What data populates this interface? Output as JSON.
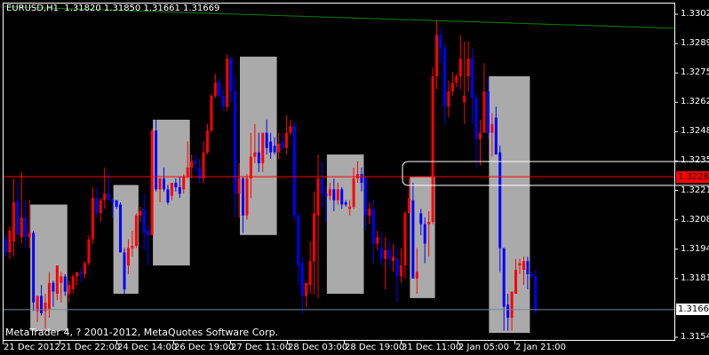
{
  "header": {
    "symbol": "EURUSD,H1",
    "open": "1.31820",
    "high": "1.31850",
    "low": "1.31661",
    "close": "1.31669"
  },
  "footer": {
    "copyright": "MetaTrader 4, ? 2001-2012, MetaQuotes Software Corp."
  },
  "colors": {
    "background": "#000000",
    "bull": "#ff0000",
    "bear": "#0000ff",
    "frame": "#ffffff",
    "box": "#aaaaaa",
    "trendline": "#008000",
    "hline": "#ff0000",
    "bid_line": "#778899"
  },
  "price_axis": {
    "labels": [
      "1.33025",
      "1.32890",
      "1.32755",
      "1.32620",
      "1.32485",
      "1.32350",
      "1.32215",
      "1.32080",
      "1.31945",
      "1.31810",
      "1.31540"
    ]
  },
  "time_axis": {
    "labels": [
      "21 Dec 2012",
      "21 Dec 22:00",
      "24 Dec 14:00",
      "26 Dec 19:00",
      "27 Dec 11:00",
      "28 Dec 03:00",
      "28 Dec 19:00",
      "31 Dec 11:00",
      "2 Jan 05:00",
      "2 Jan 21:00"
    ]
  },
  "markers": {
    "hline_price": "1.32280",
    "bid_price": "1.31669"
  },
  "chart_data": {
    "type": "candlestick",
    "ylim": [
      1.3151,
      1.3311
    ],
    "ohlc_order": "open,high,low,close",
    "candles": [
      [
        1.3199,
        1.3201,
        1.3191,
        1.3193
      ],
      [
        1.3193,
        1.3205,
        1.319,
        1.3203
      ],
      [
        1.3198,
        1.3227,
        1.3191,
        1.3216
      ],
      [
        1.3217,
        1.3225,
        1.3201,
        1.3201
      ],
      [
        1.32,
        1.323,
        1.3197,
        1.3209
      ],
      [
        1.3209,
        1.3217,
        1.3195,
        1.32
      ],
      [
        1.32,
        1.3217,
        1.3195,
        1.3202
      ],
      [
        1.3202,
        1.3203,
        1.3166,
        1.317
      ],
      [
        1.3166,
        1.3173,
        1.3161,
        1.3173
      ],
      [
        1.3173,
        1.3178,
        1.3164,
        1.3165
      ],
      [
        1.3166,
        1.3174,
        1.3158,
        1.317
      ],
      [
        1.3167,
        1.3184,
        1.3163,
        1.3179
      ],
      [
        1.3179,
        1.318,
        1.3168,
        1.3175
      ],
      [
        1.3174,
        1.3187,
        1.3171,
        1.3187
      ],
      [
        1.3179,
        1.3184,
        1.317,
        1.3182
      ],
      [
        1.3182,
        1.3183,
        1.3173,
        1.3175
      ],
      [
        1.3174,
        1.318,
        1.317,
        1.3178
      ],
      [
        1.3176,
        1.3183,
        1.3174,
        1.3182
      ],
      [
        1.3182,
        1.3184,
        1.3178,
        1.3184
      ],
      [
        1.3184,
        1.3186,
        1.3179,
        1.3183
      ],
      [
        1.3183,
        1.3189,
        1.3181,
        1.3188
      ],
      [
        1.3188,
        1.3201,
        1.3187,
        1.3199
      ],
      [
        1.3199,
        1.3223,
        1.3197,
        1.3218
      ],
      [
        1.3218,
        1.3223,
        1.3209,
        1.3211
      ],
      [
        1.3211,
        1.3218,
        1.3207,
        1.3217
      ],
      [
        1.3217,
        1.3232,
        1.3213,
        1.322
      ],
      [
        1.322,
        1.3229,
        1.3217,
        1.3217
      ],
      [
        1.3217,
        1.3218,
        1.3209,
        1.3216
      ],
      [
        1.3217,
        1.3217,
        1.3213,
        1.3214
      ],
      [
        1.3215,
        1.3216,
        1.3193,
        1.3193
      ],
      [
        1.3193,
        1.3195,
        1.3174,
        1.3176
      ],
      [
        1.3187,
        1.3199,
        1.3183,
        1.3195
      ],
      [
        1.3195,
        1.3203,
        1.3191,
        1.3196
      ],
      [
        1.3196,
        1.3211,
        1.3195,
        1.321
      ],
      [
        1.321,
        1.3214,
        1.3207,
        1.3212
      ],
      [
        1.3213,
        1.322,
        1.3194,
        1.3202
      ],
      [
        1.3203,
        1.3205,
        1.3187,
        1.3201
      ],
      [
        1.3201,
        1.325,
        1.3201,
        1.3249
      ],
      [
        1.3249,
        1.3254,
        1.3221,
        1.3222
      ],
      [
        1.3222,
        1.3227,
        1.3216,
        1.3227
      ],
      [
        1.3227,
        1.3232,
        1.3221,
        1.3222
      ],
      [
        1.3222,
        1.3224,
        1.3215,
        1.3216
      ],
      [
        1.3219,
        1.3225,
        1.3217,
        1.3225
      ],
      [
        1.3225,
        1.3227,
        1.3221,
        1.3223
      ],
      [
        1.3223,
        1.3228,
        1.3218,
        1.322
      ],
      [
        1.3222,
        1.3229,
        1.322,
        1.3228
      ],
      [
        1.3228,
        1.3244,
        1.3227,
        1.3232
      ],
      [
        1.3232,
        1.3238,
        1.3227,
        1.3235
      ],
      [
        1.3235,
        1.3238,
        1.323,
        1.3234
      ],
      [
        1.3232,
        1.3236,
        1.3225,
        1.3227
      ],
      [
        1.3227,
        1.3244,
        1.3225,
        1.3239
      ],
      [
        1.3239,
        1.3252,
        1.3238,
        1.3249
      ],
      [
        1.3249,
        1.3266,
        1.3248,
        1.3265
      ],
      [
        1.3265,
        1.3275,
        1.3264,
        1.3271
      ],
      [
        1.3271,
        1.3273,
        1.3264,
        1.3265
      ],
      [
        1.3265,
        1.3268,
        1.3258,
        1.326
      ],
      [
        1.326,
        1.3284,
        1.3258,
        1.3282
      ],
      [
        1.3282,
        1.3283,
        1.3262,
        1.3267
      ],
      [
        1.3267,
        1.3274,
        1.3209,
        1.322
      ],
      [
        1.322,
        1.3234,
        1.3209,
        1.3227
      ],
      [
        1.3227,
        1.3228,
        1.3202,
        1.321
      ],
      [
        1.321,
        1.3229,
        1.3208,
        1.3227
      ],
      [
        1.3227,
        1.3248,
        1.3218,
        1.3237
      ],
      [
        1.3237,
        1.3252,
        1.3234,
        1.3239
      ],
      [
        1.3239,
        1.3248,
        1.323,
        1.3234
      ],
      [
        1.3234,
        1.324,
        1.323,
        1.3248
      ],
      [
        1.3248,
        1.3254,
        1.3238,
        1.3241
      ],
      [
        1.3244,
        1.3248,
        1.3236,
        1.3239
      ],
      [
        1.3242,
        1.3246,
        1.3238,
        1.3239
      ],
      [
        1.3239,
        1.3248,
        1.3236,
        1.3243
      ],
      [
        1.3244,
        1.3247,
        1.324,
        1.3241
      ],
      [
        1.3241,
        1.3256,
        1.3238,
        1.3248
      ],
      [
        1.3248,
        1.3254,
        1.3247,
        1.3251
      ],
      [
        1.3251,
        1.3253,
        1.3208,
        1.321
      ],
      [
        1.321,
        1.3211,
        1.3178,
        1.3187
      ],
      [
        1.3188,
        1.3191,
        1.3165,
        1.3173
      ],
      [
        1.3173,
        1.3178,
        1.3168,
        1.3179
      ],
      [
        1.3178,
        1.3198,
        1.3174,
        1.3189
      ],
      [
        1.3189,
        1.3221,
        1.3174,
        1.3211
      ],
      [
        1.321,
        1.3238,
        1.3172,
        1.3227
      ],
      [
        1.3227,
        1.3235,
        1.3214,
        1.322
      ],
      [
        1.322,
        1.3223,
        1.3207,
        1.3219
      ],
      [
        1.3219,
        1.3225,
        1.3217,
        1.3222
      ],
      [
        1.3222,
        1.3227,
        1.3212,
        1.3217
      ],
      [
        1.3217,
        1.3225,
        1.3215,
        1.3222
      ],
      [
        1.3222,
        1.3223,
        1.3213,
        1.3215
      ],
      [
        1.3216,
        1.3217,
        1.3214,
        1.3215
      ],
      [
        1.3213,
        1.3217,
        1.321,
        1.3214
      ],
      [
        1.3214,
        1.3232,
        1.3213,
        1.3227
      ],
      [
        1.3227,
        1.3235,
        1.3225,
        1.3229
      ],
      [
        1.3229,
        1.3232,
        1.3221,
        1.3225
      ],
      [
        1.3227,
        1.3228,
        1.3203,
        1.321
      ],
      [
        1.321,
        1.3216,
        1.3206,
        1.3213
      ],
      [
        1.3213,
        1.3217,
        1.3188,
        1.3197
      ],
      [
        1.3197,
        1.3203,
        1.3194,
        1.32
      ],
      [
        1.3195,
        1.3202,
        1.3187,
        1.319
      ],
      [
        1.319,
        1.32,
        1.3176,
        1.3194
      ],
      [
        1.3194,
        1.3198,
        1.3186,
        1.319
      ],
      [
        1.3189,
        1.3197,
        1.3184,
        1.3191
      ],
      [
        1.319,
        1.3195,
        1.317,
        1.3182
      ],
      [
        1.3182,
        1.3195,
        1.3179,
        1.3187
      ],
      [
        1.3187,
        1.3212,
        1.3181,
        1.3211
      ],
      [
        1.3211,
        1.3227,
        1.3211,
        1.3218
      ],
      [
        1.3217,
        1.3225,
        1.3181,
        1.3181
      ],
      [
        1.3181,
        1.3195,
        1.3174,
        1.3184
      ],
      [
        1.3211,
        1.3213,
        1.3201,
        1.3206
      ],
      [
        1.3206,
        1.3209,
        1.3188,
        1.3197
      ],
      [
        1.3206,
        1.3212,
        1.3191,
        1.3207
      ],
      [
        1.3207,
        1.3278,
        1.3206,
        1.3274
      ],
      [
        1.3274,
        1.33,
        1.3268,
        1.3293
      ],
      [
        1.3293,
        1.3296,
        1.328,
        1.3287
      ],
      [
        1.3287,
        1.3289,
        1.3252,
        1.326
      ],
      [
        1.326,
        1.3272,
        1.3255,
        1.3267
      ],
      [
        1.3267,
        1.3276,
        1.3265,
        1.3271
      ],
      [
        1.3271,
        1.3275,
        1.3269,
        1.3274
      ],
      [
        1.3274,
        1.3293,
        1.3268,
        1.3282
      ],
      [
        1.3262,
        1.329,
        1.3252,
        1.3265
      ],
      [
        1.3274,
        1.329,
        1.3267,
        1.3282
      ],
      [
        1.3282,
        1.3287,
        1.3252,
        1.3264
      ],
      [
        1.3264,
        1.3266,
        1.3232,
        1.3245
      ],
      [
        1.3245,
        1.3254,
        1.3233,
        1.3248
      ],
      [
        1.3248,
        1.328,
        1.3248,
        1.3267
      ],
      [
        1.3267,
        1.3273,
        1.3245,
        1.3248
      ],
      [
        1.3248,
        1.3257,
        1.3237,
        1.3252
      ],
      [
        1.3255,
        1.326,
        1.3238,
        1.3238
      ],
      [
        1.3239,
        1.3242,
        1.3184,
        1.3195
      ],
      [
        1.3195,
        1.3195,
        1.3157,
        1.3168
      ],
      [
        1.3169,
        1.3174,
        1.3157,
        1.3163
      ],
      [
        1.3163,
        1.3175,
        1.3157,
        1.3175
      ],
      [
        1.3174,
        1.319,
        1.3174,
        1.3185
      ],
      [
        1.3187,
        1.319,
        1.3183,
        1.3188
      ],
      [
        1.3185,
        1.3191,
        1.3178,
        1.3189
      ],
      [
        1.3189,
        1.3191,
        1.3176,
        1.3183
      ],
      [
        1.3183,
        1.3184,
        1.3181,
        1.3182
      ],
      [
        1.3182,
        1.3185,
        1.3165,
        1.3166
      ]
    ],
    "boxes": [
      {
        "from_bar": 7,
        "to_bar": 15,
        "top": 1.3215,
        "bottom": 1.3157
      },
      {
        "from_bar": 28,
        "to_bar": 33,
        "top": 1.3224,
        "bottom": 1.3174
      },
      {
        "from_bar": 38,
        "to_bar": 46,
        "top": 1.3254,
        "bottom": 1.3187
      },
      {
        "from_bar": 60,
        "to_bar": 68,
        "top": 1.3283,
        "bottom": 1.3201
      },
      {
        "from_bar": 82,
        "to_bar": 90,
        "top": 1.3238,
        "bottom": 1.3174
      },
      {
        "from_bar": 103,
        "to_bar": 108,
        "top": 1.3228,
        "bottom": 1.3172
      },
      {
        "from_bar": 123,
        "to_bar": 132,
        "top": 1.3274,
        "bottom": 1.3156
      }
    ],
    "trendline": {
      "start": 1.3306,
      "end": 1.3296
    },
    "label_zone": {
      "top": 1.3235,
      "bottom": 1.3224
    }
  }
}
